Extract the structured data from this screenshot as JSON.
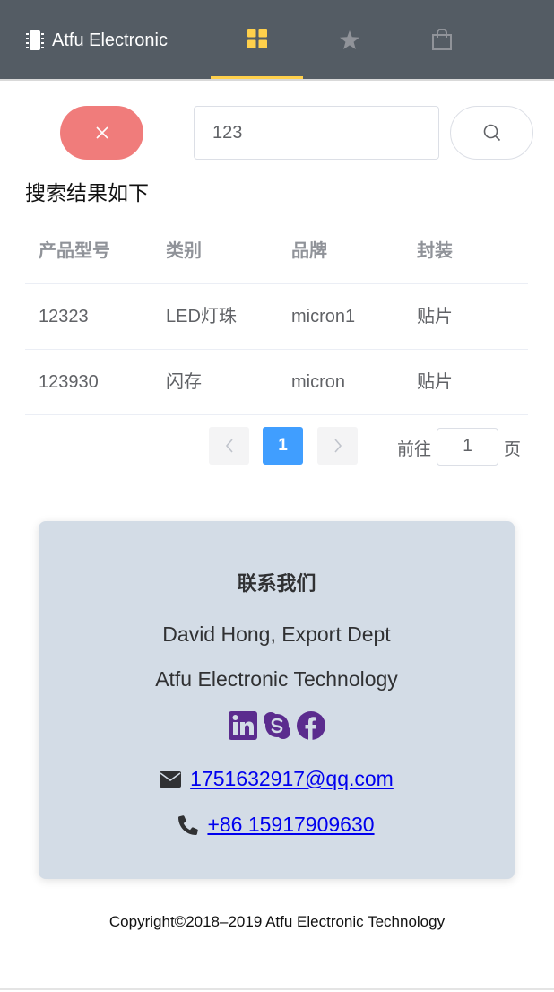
{
  "header": {
    "brand": "Atfu Electronic",
    "accent_color": "#ffd04b",
    "background_color": "#545c64",
    "tabs": [
      {
        "icon": "grid-icon",
        "active": true
      },
      {
        "icon": "star-icon",
        "active": false
      },
      {
        "icon": "shopping-bag-icon",
        "active": false
      }
    ]
  },
  "search": {
    "value": "123",
    "clear_icon": "close-icon",
    "search_icon": "search-icon",
    "clear_color": "#f07c7b"
  },
  "results": {
    "title": "搜索结果如下",
    "columns": [
      "产品型号",
      "类别",
      "品牌",
      "封装"
    ],
    "rows": [
      [
        "12323",
        "LED灯珠",
        "micron1",
        "贴片"
      ],
      [
        "123930",
        "闪存",
        "micron",
        "贴片"
      ]
    ]
  },
  "pagination": {
    "current_page": "1",
    "goto_label": "前往",
    "goto_value": "1",
    "page_label": "页",
    "active_color": "#409eff"
  },
  "contact": {
    "title": "联系我们",
    "name": "David Hong, Export Dept",
    "company": "Atfu Electronic Technology",
    "socials": [
      "linkedin-icon",
      "skype-icon",
      "facebook-icon"
    ],
    "social_color": "#5b2c8e",
    "email": "1751632917@qq.com",
    "phone": "+86 15917909630",
    "card_color": "#d3dce6"
  },
  "footer": {
    "copyright": "Copyright©2018–2019 Atfu Electronic Technology"
  }
}
